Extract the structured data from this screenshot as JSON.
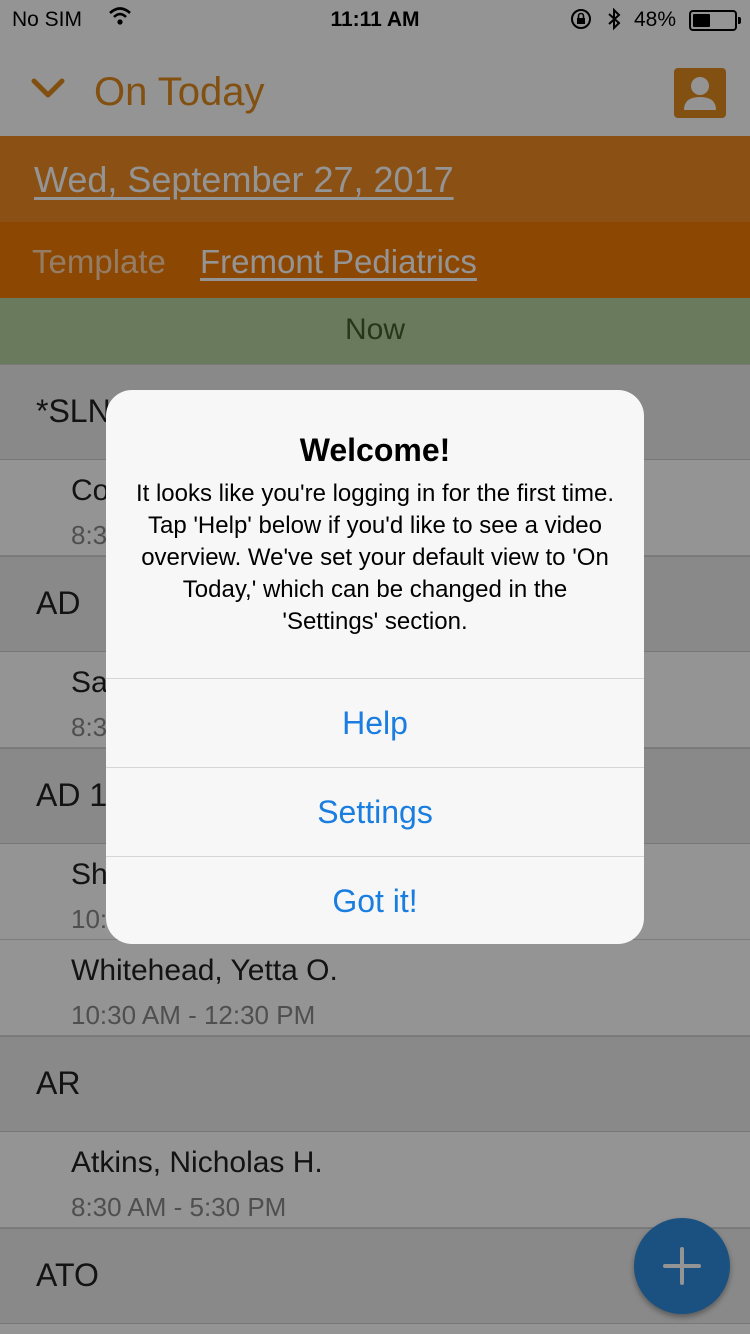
{
  "status_bar": {
    "carrier": "No SIM",
    "time": "11:11 AM",
    "battery": "48%",
    "battery_level": 0.48,
    "icons": [
      "wifi-icon",
      "rotation-lock-icon",
      "bluetooth-icon",
      "battery-icon"
    ]
  },
  "navbar": {
    "title": "On Today",
    "chevron_icon": "chevron-down-icon",
    "profile_icon": "person-icon",
    "accent": "#e08a1e"
  },
  "date_bar": {
    "date": "Wed, September 27, 2017"
  },
  "template_bar": {
    "label": "Template",
    "name": "Fremont Pediatrics"
  },
  "now_bar": {
    "label": "Now"
  },
  "list": {
    "sections": [
      {
        "name": "*SLN"
      },
      {
        "name": "AD"
      },
      {
        "name": "AD 1"
      },
      {
        "name": "AR"
      },
      {
        "name": "ATO"
      }
    ],
    "people": [
      {
        "name": "Co",
        "time": "8:3"
      },
      {
        "name": "Sa",
        "time": "8:3"
      },
      {
        "name": "Sh",
        "time": "10:"
      },
      {
        "name": "Whitehead, Yetta O.",
        "time": "10:30 AM - 12:30 PM"
      },
      {
        "name": "Atkins, Nicholas H.",
        "time": "8:30 AM - 5:30 PM"
      }
    ]
  },
  "fab": {
    "icon": "plus-icon",
    "color": "#2f8cdc"
  },
  "alert": {
    "title": "Welcome!",
    "message": "It looks like you're logging in for the first time. Tap 'Help' below if you'd like to see a video overview. We've set your default view to 'On Today,' which can be changed in the 'Settings' section.",
    "buttons": {
      "help": "Help",
      "settings": "Settings",
      "got_it": "Got it!"
    },
    "button_color": "#1a7ee0"
  }
}
